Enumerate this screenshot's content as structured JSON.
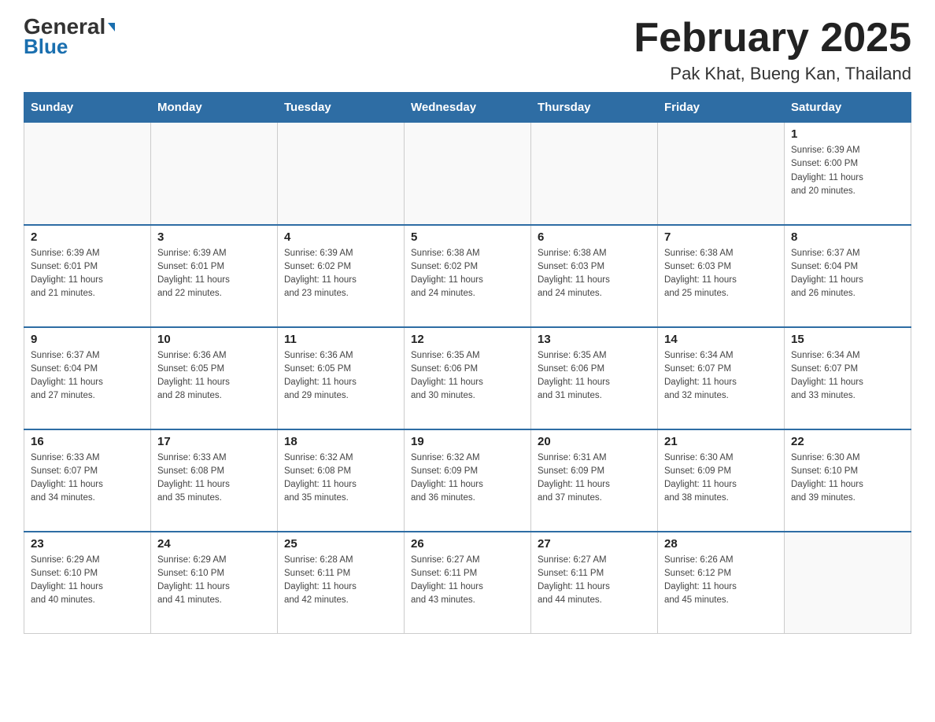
{
  "header": {
    "logo_general": "General",
    "logo_blue": "Blue",
    "month_title": "February 2025",
    "location": "Pak Khat, Bueng Kan, Thailand"
  },
  "weekdays": [
    "Sunday",
    "Monday",
    "Tuesday",
    "Wednesday",
    "Thursday",
    "Friday",
    "Saturday"
  ],
  "weeks": [
    [
      {
        "day": "",
        "info": ""
      },
      {
        "day": "",
        "info": ""
      },
      {
        "day": "",
        "info": ""
      },
      {
        "day": "",
        "info": ""
      },
      {
        "day": "",
        "info": ""
      },
      {
        "day": "",
        "info": ""
      },
      {
        "day": "1",
        "info": "Sunrise: 6:39 AM\nSunset: 6:00 PM\nDaylight: 11 hours\nand 20 minutes."
      }
    ],
    [
      {
        "day": "2",
        "info": "Sunrise: 6:39 AM\nSunset: 6:01 PM\nDaylight: 11 hours\nand 21 minutes."
      },
      {
        "day": "3",
        "info": "Sunrise: 6:39 AM\nSunset: 6:01 PM\nDaylight: 11 hours\nand 22 minutes."
      },
      {
        "day": "4",
        "info": "Sunrise: 6:39 AM\nSunset: 6:02 PM\nDaylight: 11 hours\nand 23 minutes."
      },
      {
        "day": "5",
        "info": "Sunrise: 6:38 AM\nSunset: 6:02 PM\nDaylight: 11 hours\nand 24 minutes."
      },
      {
        "day": "6",
        "info": "Sunrise: 6:38 AM\nSunset: 6:03 PM\nDaylight: 11 hours\nand 24 minutes."
      },
      {
        "day": "7",
        "info": "Sunrise: 6:38 AM\nSunset: 6:03 PM\nDaylight: 11 hours\nand 25 minutes."
      },
      {
        "day": "8",
        "info": "Sunrise: 6:37 AM\nSunset: 6:04 PM\nDaylight: 11 hours\nand 26 minutes."
      }
    ],
    [
      {
        "day": "9",
        "info": "Sunrise: 6:37 AM\nSunset: 6:04 PM\nDaylight: 11 hours\nand 27 minutes."
      },
      {
        "day": "10",
        "info": "Sunrise: 6:36 AM\nSunset: 6:05 PM\nDaylight: 11 hours\nand 28 minutes."
      },
      {
        "day": "11",
        "info": "Sunrise: 6:36 AM\nSunset: 6:05 PM\nDaylight: 11 hours\nand 29 minutes."
      },
      {
        "day": "12",
        "info": "Sunrise: 6:35 AM\nSunset: 6:06 PM\nDaylight: 11 hours\nand 30 minutes."
      },
      {
        "day": "13",
        "info": "Sunrise: 6:35 AM\nSunset: 6:06 PM\nDaylight: 11 hours\nand 31 minutes."
      },
      {
        "day": "14",
        "info": "Sunrise: 6:34 AM\nSunset: 6:07 PM\nDaylight: 11 hours\nand 32 minutes."
      },
      {
        "day": "15",
        "info": "Sunrise: 6:34 AM\nSunset: 6:07 PM\nDaylight: 11 hours\nand 33 minutes."
      }
    ],
    [
      {
        "day": "16",
        "info": "Sunrise: 6:33 AM\nSunset: 6:07 PM\nDaylight: 11 hours\nand 34 minutes."
      },
      {
        "day": "17",
        "info": "Sunrise: 6:33 AM\nSunset: 6:08 PM\nDaylight: 11 hours\nand 35 minutes."
      },
      {
        "day": "18",
        "info": "Sunrise: 6:32 AM\nSunset: 6:08 PM\nDaylight: 11 hours\nand 35 minutes."
      },
      {
        "day": "19",
        "info": "Sunrise: 6:32 AM\nSunset: 6:09 PM\nDaylight: 11 hours\nand 36 minutes."
      },
      {
        "day": "20",
        "info": "Sunrise: 6:31 AM\nSunset: 6:09 PM\nDaylight: 11 hours\nand 37 minutes."
      },
      {
        "day": "21",
        "info": "Sunrise: 6:30 AM\nSunset: 6:09 PM\nDaylight: 11 hours\nand 38 minutes."
      },
      {
        "day": "22",
        "info": "Sunrise: 6:30 AM\nSunset: 6:10 PM\nDaylight: 11 hours\nand 39 minutes."
      }
    ],
    [
      {
        "day": "23",
        "info": "Sunrise: 6:29 AM\nSunset: 6:10 PM\nDaylight: 11 hours\nand 40 minutes."
      },
      {
        "day": "24",
        "info": "Sunrise: 6:29 AM\nSunset: 6:10 PM\nDaylight: 11 hours\nand 41 minutes."
      },
      {
        "day": "25",
        "info": "Sunrise: 6:28 AM\nSunset: 6:11 PM\nDaylight: 11 hours\nand 42 minutes."
      },
      {
        "day": "26",
        "info": "Sunrise: 6:27 AM\nSunset: 6:11 PM\nDaylight: 11 hours\nand 43 minutes."
      },
      {
        "day": "27",
        "info": "Sunrise: 6:27 AM\nSunset: 6:11 PM\nDaylight: 11 hours\nand 44 minutes."
      },
      {
        "day": "28",
        "info": "Sunrise: 6:26 AM\nSunset: 6:12 PM\nDaylight: 11 hours\nand 45 minutes."
      },
      {
        "day": "",
        "info": ""
      }
    ]
  ]
}
